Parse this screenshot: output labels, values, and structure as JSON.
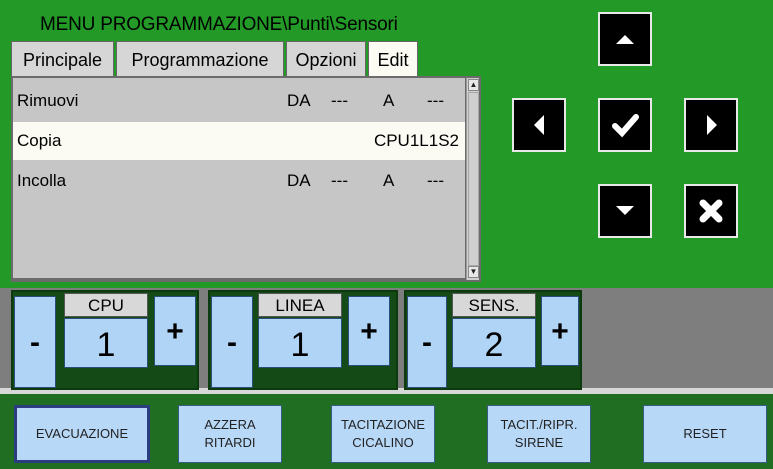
{
  "title": "MENU PROGRAMMAZIONE\\Punti\\Sensori",
  "tabs": [
    {
      "label": "Principale"
    },
    {
      "label": "Programmazione"
    },
    {
      "label": "Opzioni"
    },
    {
      "label": "Edit"
    }
  ],
  "list": {
    "rows": [
      {
        "name": "Rimuovi",
        "col1": "DA",
        "col2": "---",
        "col3": "A",
        "col4": "---"
      },
      {
        "name": "Copia",
        "value": "CPU1L1S2"
      },
      {
        "name": "Incolla",
        "col1": "DA",
        "col2": "---",
        "col3": "A",
        "col4": "---"
      }
    ]
  },
  "nav_buttons": [
    "arrow-up-icon",
    "arrow-left-icon",
    "check-icon",
    "arrow-right-icon",
    "arrow-down-icon",
    "cross-icon"
  ],
  "steppers": [
    {
      "label": "CPU",
      "value": "1",
      "minus": "-",
      "plus": "+"
    },
    {
      "label": "LINEA",
      "value": "1",
      "minus": "-",
      "plus": "+"
    },
    {
      "label": "SENS.",
      "value": "2",
      "minus": "-",
      "plus": "+"
    }
  ],
  "commands": [
    {
      "line1": "EVACUAZIONE",
      "line2": ""
    },
    {
      "line1": "AZZERA",
      "line2": "RITARDI"
    },
    {
      "line1": "TACITAZIONE",
      "line2": "CICALINO"
    },
    {
      "line1": "TACIT./RIPR.",
      "line2": "SIRENE"
    },
    {
      "line1": "RESET",
      "line2": ""
    }
  ],
  "colors": {
    "panel_green": "#239a27",
    "button_blue": "#b0d4f6",
    "nav_black": "#000000",
    "selected_row": "#fbfbf3"
  }
}
